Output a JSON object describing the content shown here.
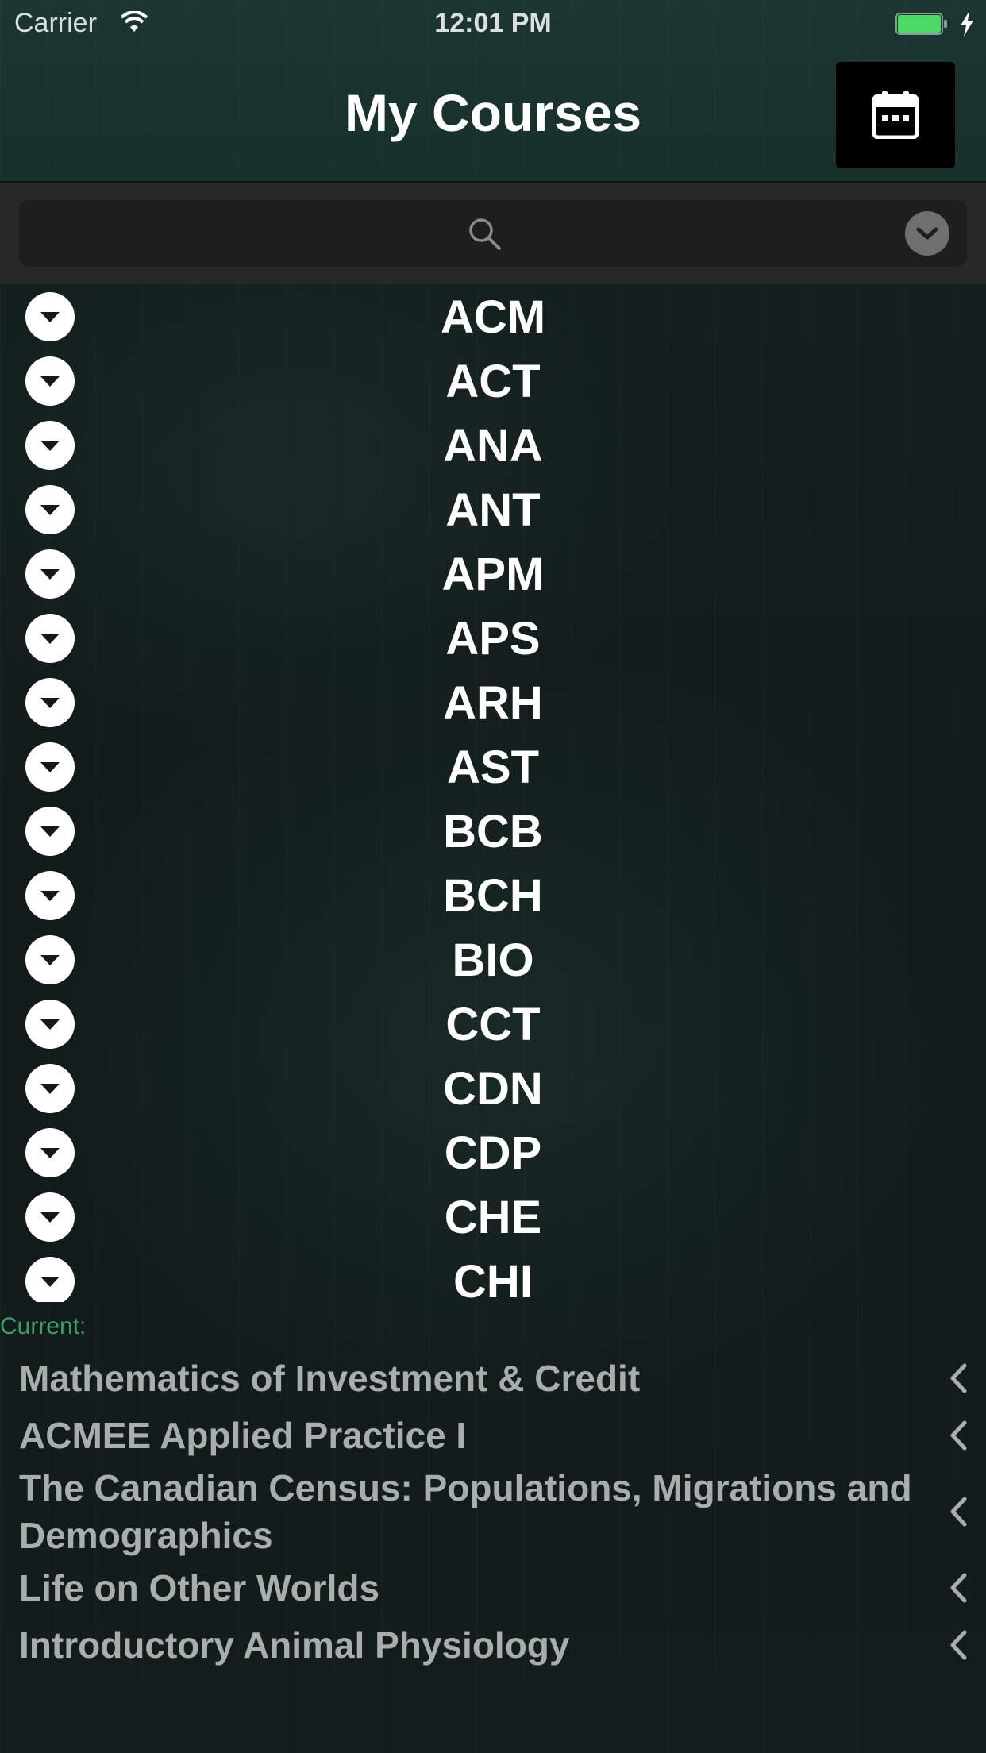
{
  "status_bar": {
    "carrier": "Carrier",
    "time": "12:01 PM",
    "icons": [
      "wifi-icon",
      "battery-icon",
      "charging-icon"
    ],
    "battery_color": "#4cd964"
  },
  "nav": {
    "title": "My Courses",
    "calendar_icon": "calendar-icon"
  },
  "search": {
    "placeholder": "",
    "search_icon": "search-icon",
    "dropdown_icon": "chevron-down-icon"
  },
  "subjects": [
    {
      "code": "ACM"
    },
    {
      "code": "ACT"
    },
    {
      "code": "ANA"
    },
    {
      "code": "ANT"
    },
    {
      "code": "APM"
    },
    {
      "code": "APS"
    },
    {
      "code": "ARH"
    },
    {
      "code": "AST"
    },
    {
      "code": "BCB"
    },
    {
      "code": "BCH"
    },
    {
      "code": "BIO"
    },
    {
      "code": "CCT"
    },
    {
      "code": "CDN"
    },
    {
      "code": "CDP"
    },
    {
      "code": "CHE"
    },
    {
      "code": "CHI"
    }
  ],
  "current": {
    "label": "Current:",
    "label_color": "#3c9f6a",
    "courses": [
      {
        "title": "Mathematics of Investment & Credit"
      },
      {
        "title": "ACMEE Applied Practice I"
      },
      {
        "title": "The Canadian Census: Populations, Migrations and Demographics"
      },
      {
        "title": "Life on Other Worlds"
      },
      {
        "title": "Introductory Animal Physiology"
      }
    ]
  }
}
